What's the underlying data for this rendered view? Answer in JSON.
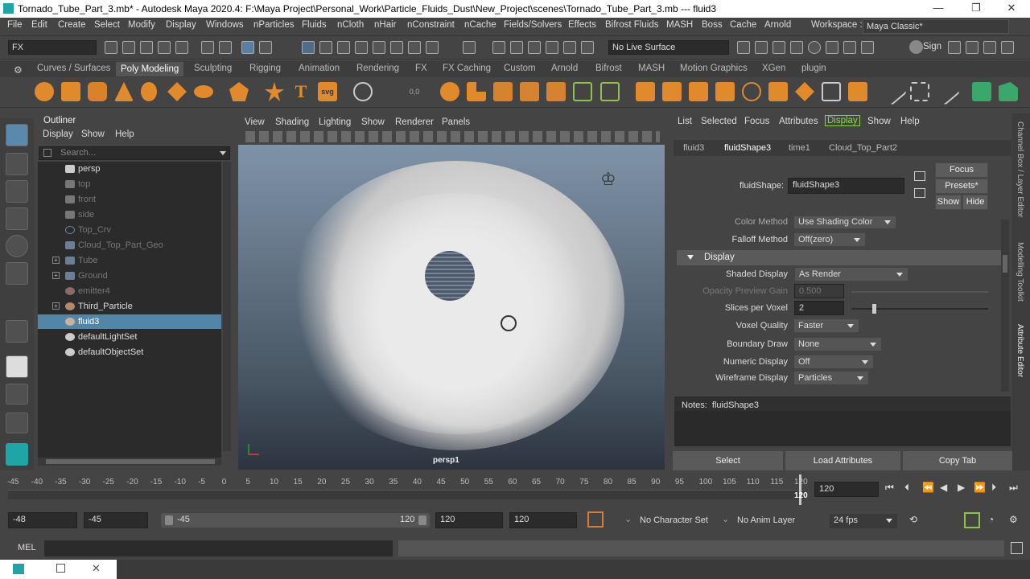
{
  "window": {
    "title": "Tornado_Tube_Part_3.mb* - Autodesk Maya 2020.4: F:\\Maya Project\\Personal_Work\\Particle_Fluids_Dust\\New_Project\\scenes\\Tornado_Tube_Part_3.mb  ---  fluid3",
    "min": "—",
    "max": "❐",
    "close": "✕"
  },
  "menu": [
    "File",
    "Edit",
    "Create",
    "Select",
    "Modify",
    "Display",
    "Windows",
    "nParticles",
    "Fluids",
    "nCloth",
    "nHair",
    "nConstraint",
    "nCache",
    "Fields/Solvers",
    "Effects",
    "Bifrost Fluids",
    "MASH",
    "Boss",
    "Cache",
    "Arnold"
  ],
  "workspace": {
    "label": "Workspace :",
    "value": "Maya Classic*"
  },
  "toolbar": {
    "mode": "FX",
    "live_surface": "No Live Surface",
    "sign_in": "Sign"
  },
  "shelf_tabs": [
    "Curves / Surfaces",
    "Poly Modeling",
    "Sculpting",
    "Rigging",
    "Animation",
    "Rendering",
    "FX",
    "FX Caching",
    "Custom",
    "Arnold",
    "Bifrost",
    "MASH",
    "Motion Graphics",
    "XGen",
    "plugin"
  ],
  "shelf_active": "Poly Modeling",
  "shelf_text": {
    "t": "T",
    "svg": "svg",
    "num": "0,0"
  },
  "outliner": {
    "title": "Outliner",
    "menu": [
      "Display",
      "Show",
      "Help"
    ],
    "search_placeholder": "Search...",
    "items": [
      {
        "label": "persp",
        "dim": false,
        "expand": ""
      },
      {
        "label": "top",
        "dim": true,
        "expand": ""
      },
      {
        "label": "front",
        "dim": true,
        "expand": ""
      },
      {
        "label": "side",
        "dim": true,
        "expand": ""
      },
      {
        "label": "Top_Crv",
        "dim": true,
        "expand": ""
      },
      {
        "label": "Cloud_Top_Part_Geo",
        "dim": true,
        "expand": ""
      },
      {
        "label": "Tube",
        "dim": true,
        "expand": "+"
      },
      {
        "label": "Ground",
        "dim": true,
        "expand": "+"
      },
      {
        "label": "emitter4",
        "dim": true,
        "expand": ""
      },
      {
        "label": "Third_Particle",
        "dim": false,
        "expand": "+"
      },
      {
        "label": "fluid3",
        "dim": false,
        "expand": "",
        "selected": true
      },
      {
        "label": "defaultLightSet",
        "dim": false,
        "expand": ""
      },
      {
        "label": "defaultObjectSet",
        "dim": false,
        "expand": ""
      }
    ]
  },
  "viewport": {
    "menu": [
      "View",
      "Shading",
      "Lighting",
      "Show",
      "Renderer",
      "Panels"
    ],
    "camera": "persp1"
  },
  "attr_editor": {
    "menu": [
      "List",
      "Selected",
      "Focus",
      "Attributes",
      "Display",
      "Show",
      "Help"
    ],
    "tabs": [
      "fluid3",
      "fluidShape3",
      "time1",
      "Cloud_Top_Part2"
    ],
    "active_tab": "fluidShape3",
    "shape_label": "fluidShape:",
    "shape_value": "fluidShape3",
    "buttons": {
      "focus": "Focus",
      "presets": "Presets*",
      "show": "Show",
      "hide": "Hide"
    },
    "color_method": {
      "label": "Color Method",
      "value": "Use Shading Color"
    },
    "falloff": {
      "label": "Falloff Method",
      "value": "Off(zero)"
    },
    "section": "Display",
    "rows": [
      {
        "label": "Shaded Display",
        "value": "As Render",
        "dim": false
      },
      {
        "label": "Opacity Preview Gain",
        "value": "0.500",
        "dim": true
      },
      {
        "label": "Slices per Voxel",
        "value": "2",
        "dim": false
      },
      {
        "label": "Voxel Quality",
        "value": "Faster",
        "dim": false
      },
      {
        "label": "Boundary Draw",
        "value": "None",
        "dim": false
      },
      {
        "label": "Numeric Display",
        "value": "Off",
        "dim": false
      },
      {
        "label": "Wireframe Display",
        "value": "Particles",
        "dim": false
      }
    ],
    "notes_label": "Notes:  fluidShape3",
    "bottom": {
      "select": "Select",
      "load": "Load Attributes",
      "copy": "Copy Tab"
    }
  },
  "side_labels": [
    "Channel Box / Layer Editor",
    "Modelling Toolkit",
    "Attribute Editor"
  ],
  "timeline": {
    "ticks": [
      "-45",
      "-40",
      "-35",
      "-30",
      "-25",
      "-20",
      "-15",
      "-10",
      "-5",
      "0",
      "5",
      "10",
      "15",
      "20",
      "25",
      "30",
      "35",
      "40",
      "45",
      "50",
      "55",
      "60",
      "65",
      "70",
      "75",
      "80",
      "85",
      "90",
      "95",
      "100",
      "105",
      "110",
      "115",
      "120"
    ],
    "current": "120",
    "frame_field": "120"
  },
  "range": {
    "start": "-48",
    "anim_start": "-45",
    "slider_start": "-45",
    "slider_end": "120",
    "anim_end": "120",
    "end": "120",
    "char_set": "No Character Set",
    "anim_layer": "No Anim Layer",
    "fps": "24 fps"
  },
  "cmd": {
    "lang": "MEL"
  }
}
